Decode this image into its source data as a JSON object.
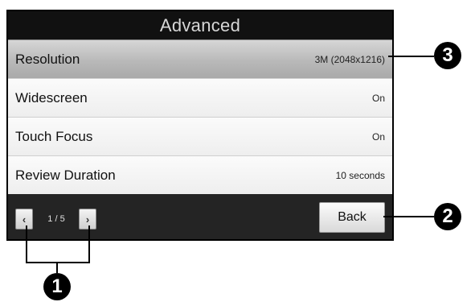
{
  "screen": {
    "title": "Advanced",
    "settings": [
      {
        "label": "Resolution",
        "value": "3M (2048x1216)",
        "selected": true
      },
      {
        "label": "Widescreen",
        "value": "On"
      },
      {
        "label": "Touch Focus",
        "value": "On"
      },
      {
        "label": "Review Duration",
        "value": "10 seconds"
      }
    ],
    "pager": {
      "prev_icon": "chevron-left-icon",
      "next_icon": "chevron-right-icon",
      "page_text": "1 / 5"
    },
    "back_label": "Back"
  },
  "callouts": {
    "one": "1",
    "two": "2",
    "three": "3"
  }
}
